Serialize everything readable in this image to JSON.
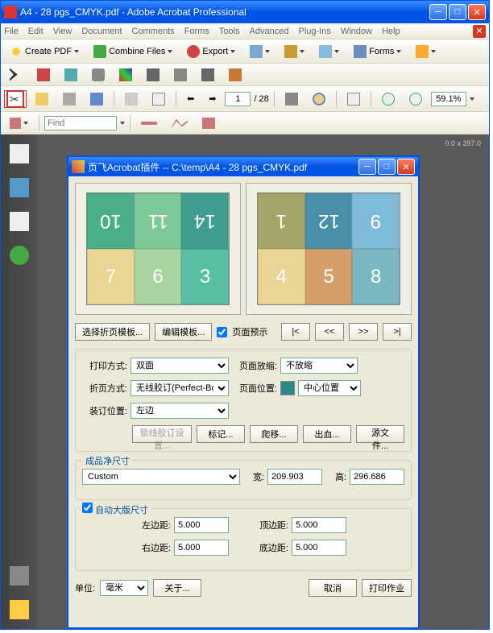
{
  "window": {
    "title": "A4 - 28 pgs_CMYK.pdf - Adobe Acrobat Professional"
  },
  "menu": {
    "file": "File",
    "edit": "Edit",
    "view": "View",
    "document": "Document",
    "comments": "Comments",
    "forms": "Forms",
    "tools": "Tools",
    "advanced": "Advanced",
    "plugins": "Plug-Ins",
    "window": "Window",
    "help": "Help"
  },
  "toolbar1": {
    "create_pdf": "Create PDF",
    "combine_files": "Combine Files",
    "export": "Export",
    "forms": "Forms"
  },
  "nav": {
    "page": "1",
    "total": "/ 28",
    "zoom": "59.1%",
    "find_placeholder": "Find"
  },
  "ruler": "0.0 x 297.0",
  "dialog": {
    "title": "页飞Acrobat插件 -- C:\\temp\\A4 - 28 pgs_CMYK.pdf",
    "select_template": "选择折页模板...",
    "edit_template": "编辑模板...",
    "page_preview": "页面预示",
    "nav_first": "|<",
    "nav_prev": "<<",
    "nav_next": ">>",
    "nav_last": ">|",
    "print_mode_label": "打印方式:",
    "print_mode": "双面",
    "page_fit_label": "页面放缩:",
    "page_fit": "不放缩",
    "fold_mode_label": "折页方式:",
    "fold_mode": "无线胶订(Perfect-Bound)",
    "page_pos_label": "页面位置:",
    "page_pos": "中心位置",
    "bind_pos_label": "装订位置:",
    "bind_pos": "左边",
    "saddle_settings": "锁线胶订设置...",
    "marks": "标记...",
    "creep": "爬移...",
    "bleed": "出血...",
    "source": "源文件...",
    "finish_size": "成品净尺寸",
    "finish_preset": "Custom",
    "width_label": "宽:",
    "width": "209.903",
    "height_label": "高:",
    "height": "296.686",
    "auto_layout": "自动大版尺寸",
    "left_margin_label": "左边距:",
    "left_margin": "5.000",
    "top_margin_label": "顶边距:",
    "top_margin": "5.000",
    "right_margin_label": "右边距:",
    "right_margin": "5.000",
    "bottom_margin_label": "底边距:",
    "bottom_margin": "5.000",
    "unit_label": "单位:",
    "unit": "毫米",
    "about": "关于...",
    "cancel": "取消",
    "print_job": "打印作业"
  },
  "preview": {
    "left": [
      {
        "n": "10",
        "color": "#49b08a",
        "flip": true
      },
      {
        "n": "11",
        "color": "#7dc997",
        "flip": true
      },
      {
        "n": "14",
        "color": "#3f9e8e",
        "flip": true
      },
      {
        "n": "7",
        "color": "#e9d596",
        "flip": false
      },
      {
        "n": "6",
        "color": "#a8d6a0",
        "flip": false
      },
      {
        "n": "3",
        "color": "#57bfa2",
        "flip": false
      }
    ],
    "right": [
      {
        "n": "1",
        "color": "#a5a56a",
        "flip": true
      },
      {
        "n": "12",
        "color": "#4a8fa8",
        "flip": true
      },
      {
        "n": "9",
        "color": "#7ebbd8",
        "flip": true
      },
      {
        "n": "4",
        "color": "#e9d596",
        "flip": false
      },
      {
        "n": "5",
        "color": "#d69f6a",
        "flip": false
      },
      {
        "n": "8",
        "color": "#7bb8c2",
        "flip": false
      }
    ]
  }
}
